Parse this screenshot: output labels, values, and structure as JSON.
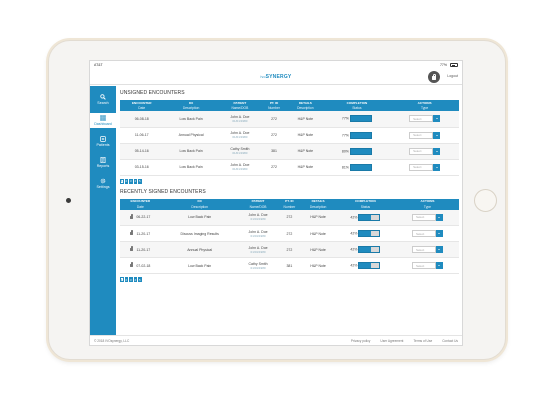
{
  "statusbar": {
    "carrier": "AT&T",
    "battery": "77%"
  },
  "header": {
    "brand_prefix": "ivo",
    "brand": "SYNERGY",
    "logout": "Logout"
  },
  "sidebar": {
    "items": [
      {
        "label": "Search",
        "icon": "search-icon"
      },
      {
        "label": "Dashboard",
        "icon": "dashboard-icon",
        "active": true
      },
      {
        "label": "Patients",
        "icon": "patients-icon"
      },
      {
        "label": "Reports",
        "icon": "reports-icon"
      },
      {
        "label": "Settings",
        "icon": "settings-icon"
      }
    ]
  },
  "unsigned": {
    "title": "UNSIGNED ENCOUNTERS",
    "headers_top": [
      "ENCOUNTER",
      "DX",
      "PATIENT",
      "PT. ID",
      "DETAILS",
      "COMPLETION",
      "ACTIONS"
    ],
    "headers_sub": [
      "Date",
      "Description",
      "Name/DOB",
      "Number",
      "Description",
      "Status",
      "Type"
    ],
    "rows": [
      {
        "date": "06-08-18",
        "dx": "Low Back Pain",
        "name": "John A. Doe",
        "dob": "01/01/1980",
        "ptid": "272",
        "details": "H&P Note",
        "pct": "77%",
        "select": "Select"
      },
      {
        "date": "11-06-17",
        "dx": "Annual Physical",
        "name": "John A. Doe",
        "dob": "01/01/1980",
        "ptid": "272",
        "details": "H&P Note",
        "pct": "77%",
        "select": "Select"
      },
      {
        "date": "05-14-16",
        "dx": "Low Back Pain",
        "name": "Cathy Smith",
        "dob": "01/01/1980",
        "ptid": "381",
        "details": "H&P Note",
        "pct": "80%",
        "select": "Select"
      },
      {
        "date": "03-15-16",
        "dx": "Low Back Pain",
        "name": "John A. Doe",
        "dob": "01/01/1980",
        "ptid": "272",
        "details": "H&P Note",
        "pct": "81%",
        "select": "Select"
      }
    ],
    "pages": [
      "1",
      "2",
      "3",
      "4",
      "5"
    ]
  },
  "signed": {
    "title": "RECENTLY SIGNED ENCOUNTERS",
    "headers_top": [
      "ENCOUNTER",
      "DX",
      "PATIENT",
      "PT. ID",
      "DETAILS",
      "COMPLETION",
      "ACTIONS"
    ],
    "headers_sub": [
      "Date",
      "Description",
      "Name/DOB",
      "Number",
      "Description",
      "Status",
      "Type"
    ],
    "rows": [
      {
        "date": "06-22-17",
        "dx": "Low Back Pain",
        "name": "John A. Doe",
        "dob": "01/01/1980",
        "ptid": "272",
        "details": "H&P Note",
        "pct": "42%",
        "select": "Select"
      },
      {
        "date": "11-20-17",
        "dx": "Discuss Imaging Results",
        "name": "John A. Doe",
        "dob": "01/01/1980",
        "ptid": "272",
        "details": "H&P Note",
        "pct": "42%",
        "select": "Select"
      },
      {
        "date": "11-20-17",
        "dx": "Annual Physical",
        "name": "John A. Doe",
        "dob": "01/01/1980",
        "ptid": "272",
        "details": "H&P Note",
        "pct": "42%",
        "select": "Select"
      },
      {
        "date": "07-02-18",
        "dx": "Low Back Pain",
        "name": "Cathy Smith",
        "dob": "01/01/1980",
        "ptid": "381",
        "details": "H&P Note",
        "pct": "42%",
        "select": "Select"
      }
    ],
    "pages": [
      "1",
      "2",
      "3",
      "4",
      "5"
    ]
  },
  "footer": {
    "copyright": "© 2018 IVOsynergy, LLC",
    "links": [
      "Privacy policy",
      "User Agreement",
      "Terms of Use",
      "Contact Us"
    ]
  }
}
